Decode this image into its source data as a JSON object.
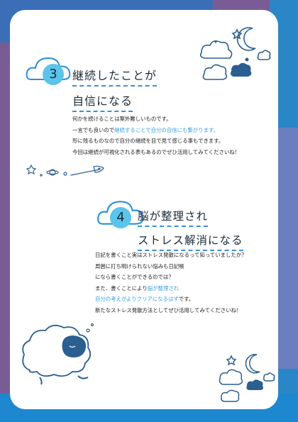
{
  "section3": {
    "number": "3",
    "title_line1": "継続したことが",
    "title_line2": "自信になる",
    "lines": [
      {
        "parts": [
          {
            "t": "何かを続けることは案外難しいものです。",
            "c": "black"
          }
        ]
      },
      {
        "parts": [
          {
            "t": "一言でも良いので",
            "c": "black"
          },
          {
            "t": "継続することで自分の自信にも繋がります。",
            "c": "blue"
          }
        ]
      },
      {
        "parts": [
          {
            "t": "形に残るものなので自分の継続を目で見て感じる事もできます。",
            "c": "black"
          }
        ]
      },
      {
        "parts": [
          {
            "t": "今回は継続が可視化される表もあるのでぜひ活用してみてくださいね！",
            "c": "black"
          }
        ]
      }
    ]
  },
  "section4": {
    "number": "4",
    "title_line1": "脳が整理され",
    "title_line2": "ストレス解消になる",
    "lines": [
      {
        "parts": [
          {
            "t": "日記を書くこと実はストレス発散になるって知っていましたか？",
            "c": "black"
          }
        ]
      },
      {
        "parts": [
          {
            "t": "周囲に打ち明けられない悩みも日記帳",
            "c": "black"
          }
        ]
      },
      {
        "parts": [
          {
            "t": "になら書くことができるのでは？",
            "c": "black"
          }
        ]
      },
      {
        "parts": [
          {
            "t": "また、書くことにより",
            "c": "black"
          },
          {
            "t": "脳が整理され",
            "c": "blue"
          }
        ]
      },
      {
        "parts": [
          {
            "t": "自分の考えがよりクリアになるはず",
            "c": "blue"
          },
          {
            "t": "です。",
            "c": "black"
          }
        ]
      },
      {
        "parts": [
          {
            "t": "新たなストレス発散方法としてぜひ活用してみてくださいね！",
            "c": "black"
          }
        ]
      }
    ]
  },
  "colors": {
    "accent_blue": "#3aa0e0",
    "circle_blue": "#5bc4ea",
    "navy": "#2b5f8f"
  }
}
